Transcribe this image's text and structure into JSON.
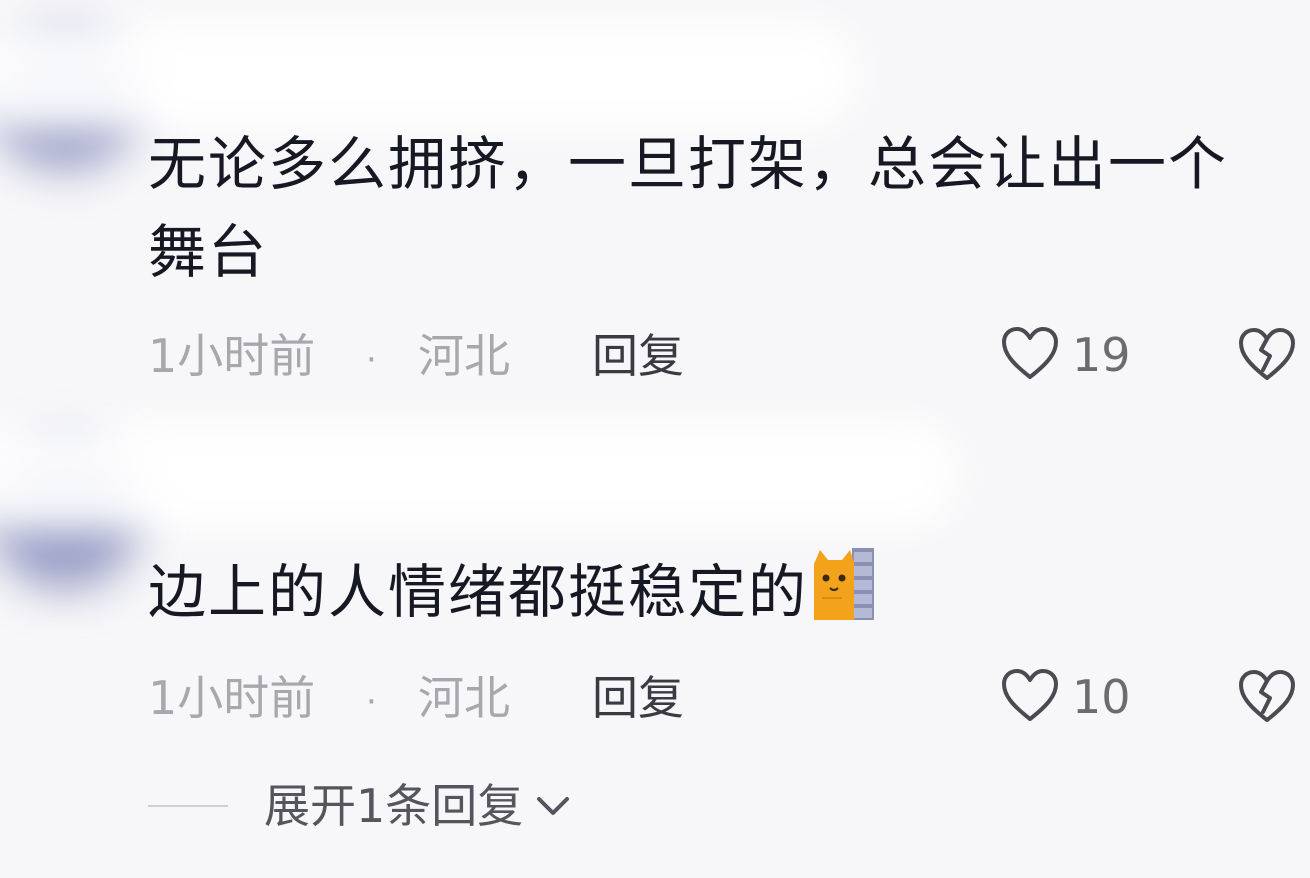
{
  "comments": [
    {
      "text": "无论多么拥挤，一旦打架，总会让出一个舞台",
      "time": "1小时前",
      "separator": "·",
      "location": "河北",
      "reply_label": "回复",
      "likes": "19"
    },
    {
      "text": "边上的人情绪都挺稳定的",
      "emoji": "cat-peeking-behind-wall-emoji",
      "time": "1小时前",
      "separator": "·",
      "location": "河北",
      "reply_label": "回复",
      "likes": "10"
    }
  ],
  "expand": {
    "label": "展开1条回复"
  },
  "icons": {
    "like": "heart-outline-icon",
    "dislike": "broken-heart-icon",
    "expand": "chevron-down-icon"
  },
  "colors": {
    "text": "#161823",
    "meta": "#a7a7ad",
    "background": "#f7f7f9",
    "avatar_blur": "#7e86b8"
  }
}
